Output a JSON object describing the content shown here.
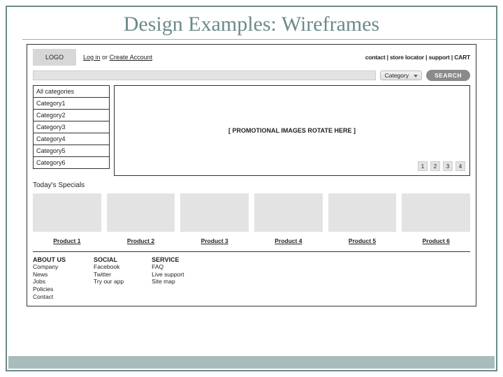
{
  "slide": {
    "title": "Design Examples: Wireframes"
  },
  "topbar": {
    "logo": "LOGO",
    "auth_login": "Log in",
    "auth_or": " or ",
    "auth_create": "Create Account",
    "links_contact": "contact",
    "links_locator": "store locator",
    "links_support": "support",
    "links_cart": "CART",
    "sep": " | "
  },
  "search": {
    "placeholder": "",
    "category_label": "Category",
    "button_label": "SEARCH"
  },
  "categories": [
    "All categories",
    "Category1",
    "Category2",
    "Category3",
    "Category4",
    "Category5",
    "Category6"
  ],
  "promo": {
    "label": "[ PROMOTIONAL IMAGES ROTATE HERE ]",
    "pages": [
      "1",
      "2",
      "3",
      "4"
    ]
  },
  "specials": {
    "heading": "Today's Specials",
    "products": [
      "Product 1",
      "Product 2",
      "Product 3",
      "Product 4",
      "Product 5",
      "Product 6"
    ]
  },
  "footer": {
    "cols": [
      {
        "head": "ABOUT US",
        "items": [
          "Company",
          "News",
          "Jobs",
          "Policies",
          "Contact"
        ]
      },
      {
        "head": "SOCIAL",
        "items": [
          "Facebook",
          "Twitter",
          "Try our app"
        ]
      },
      {
        "head": "SERVICE",
        "items": [
          "FAQ",
          "Live support",
          "Site map"
        ]
      }
    ]
  }
}
